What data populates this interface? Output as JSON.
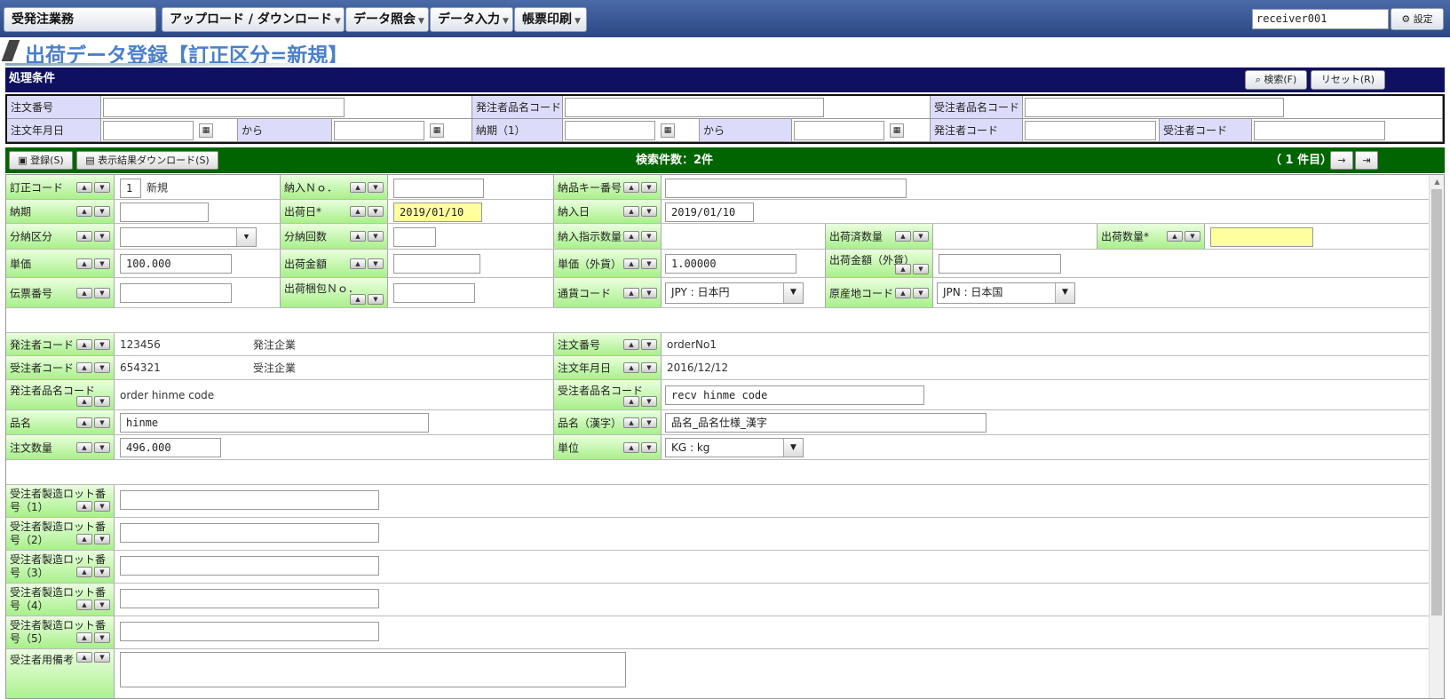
{
  "topbar": {
    "app_name": "受発注業務",
    "menus": [
      "アップロード / ダウンロード",
      "データ照会",
      "データ入力",
      "帳票印刷"
    ],
    "user_value": "receiver001",
    "settings_label": "設定"
  },
  "page_title": "出荷データ登録【訂正区分=新規】",
  "conditions": {
    "header": "処理条件",
    "search_label": "検索(F)",
    "reset_label": "リセット(R)",
    "order_no_label": "注文番号",
    "orderer_item_code_label": "発注者品名コード",
    "receiver_item_code_label": "受注者品名コード",
    "order_date_label": "注文年月日",
    "from_label": "から",
    "delivery_label": "納期（1）",
    "from_label2": "から",
    "orderer_code_label": "発注者コード",
    "receiver_code_label": "受注者コード"
  },
  "results": {
    "register_label": "登録(S)",
    "download_label": "表示結果ダウンロード(S)",
    "count_text": "検索件数：2件",
    "page_text": "（ 1 件目）"
  },
  "form": {
    "correction_code": {
      "label": "訂正コード",
      "value": "1",
      "text": "新規"
    },
    "delivery_no": {
      "label": "納入Ｎｏ．"
    },
    "delivery_key_no": {
      "label": "納品キー番号"
    },
    "due_date": {
      "label": "納期"
    },
    "ship_date": {
      "label": "出荷日*",
      "value": "2019/01/10"
    },
    "delivery_date": {
      "label": "納入日",
      "value": "2019/01/10"
    },
    "split_type": {
      "label": "分納区分"
    },
    "split_count": {
      "label": "分納回数"
    },
    "delivery_instruction_qty": {
      "label": "納入指示数量"
    },
    "shipped_qty": {
      "label": "出荷済数量"
    },
    "ship_qty": {
      "label": "出荷数量*"
    },
    "unit_price": {
      "label": "単価",
      "value": "100.000"
    },
    "ship_amount": {
      "label": "出荷金額"
    },
    "unit_price_fc": {
      "label": "単価（外貨）",
      "value": "1.00000"
    },
    "ship_amount_fc": {
      "label": "出荷金額（外貨）"
    },
    "slip_no": {
      "label": "伝票番号"
    },
    "ship_package_no": {
      "label": "出荷梱包Ｎｏ．"
    },
    "currency_code": {
      "label": "通貨コード",
      "value": "JPY : 日本円"
    },
    "origin_code": {
      "label": "原産地コード",
      "value": "JPN : 日本国"
    },
    "orderer_code": {
      "label": "発注者コード",
      "value": "123456",
      "name": "発注企業"
    },
    "order_no": {
      "label": "注文番号",
      "value": "orderNo1"
    },
    "receiver_code": {
      "label": "受注者コード",
      "value": "654321",
      "name": "受注企業"
    },
    "order_date": {
      "label": "注文年月日",
      "value": "2016/12/12"
    },
    "orderer_item_code": {
      "label": "発注者品名コード",
      "value": "order hinme code"
    },
    "receiver_item_code": {
      "label": "受注者品名コード",
      "value": "recv hinme code"
    },
    "item_name": {
      "label": "品名",
      "value": "hinme"
    },
    "item_name_kanji": {
      "label": "品名（漢字）",
      "value": "品名_品名仕様_漢字"
    },
    "order_qty": {
      "label": "注文数量",
      "value": "496.000"
    },
    "unit": {
      "label": "単位",
      "value": "KG : kg"
    },
    "lot_labels": [
      "受注者製造ロット番号（1）",
      "受注者製造ロット番号（2）",
      "受注者製造ロット番号（3）",
      "受注者製造ロット番号（4）",
      "受注者製造ロット番号（5）"
    ],
    "lot_line1": "受注者製造ロット番",
    "lot_line2": [
      "号（1）",
      "号（2）",
      "号（3）",
      "号（4）",
      "号（5）"
    ],
    "receiver_remarks": {
      "label": "受注者用備考"
    }
  }
}
